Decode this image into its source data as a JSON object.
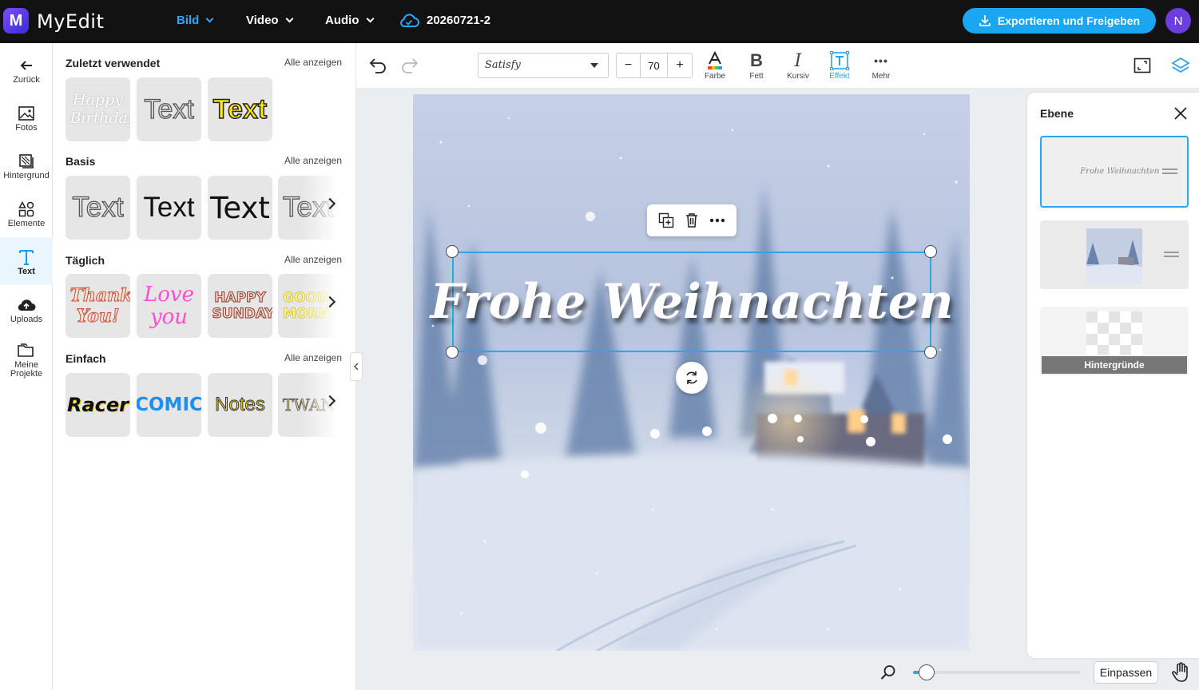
{
  "app": {
    "name": "MyEdit",
    "logo_letter": "M",
    "user_initial": "N"
  },
  "topnav": [
    {
      "label": "Bild",
      "active": true
    },
    {
      "label": "Video",
      "active": false
    },
    {
      "label": "Audio",
      "active": false
    }
  ],
  "project": {
    "name": "20260721-2"
  },
  "export_label": "Exportieren und Freigeben",
  "rail": [
    {
      "label": "Zurück",
      "icon": "back-arrow-icon"
    },
    {
      "label": "Fotos",
      "icon": "photo-icon"
    },
    {
      "label": "Hintergrund",
      "icon": "background-icon"
    },
    {
      "label": "Elemente",
      "icon": "shapes-icon"
    },
    {
      "label": "Text",
      "icon": "text-icon",
      "active": true
    },
    {
      "label": "Uploads",
      "icon": "upload-cloud-icon"
    },
    {
      "label": "Meine Projekte",
      "icon": "folder-icon"
    }
  ],
  "panel": {
    "show_all": "Alle anzeigen",
    "sections": [
      {
        "title": "Zuletzt verwendet",
        "tiles": [
          "Happy Birthday",
          "Text",
          "Text"
        ]
      },
      {
        "title": "Basis",
        "tiles": [
          "Text",
          "Text",
          "Text",
          "Text"
        ]
      },
      {
        "title": "Täglich",
        "tiles": [
          "Thank You!",
          "Love you",
          "HAPPY SUNDAY",
          "GOOD MORNING"
        ]
      },
      {
        "title": "Einfach",
        "tiles": [
          "Racer",
          "COMIC",
          "Notes",
          "TWANG"
        ]
      }
    ]
  },
  "toolbar": {
    "font": "Satisfy",
    "size": "70",
    "minus": "−",
    "plus": "+",
    "tools": [
      {
        "label": "Farbe",
        "glyph": "A"
      },
      {
        "label": "Fett",
        "glyph": "B"
      },
      {
        "label": "Kursiv",
        "glyph": "I"
      },
      {
        "label": "Effekt",
        "glyph": "T",
        "active": true
      },
      {
        "label": "Mehr",
        "glyph": "•••"
      }
    ]
  },
  "canvas": {
    "text": "Frohe Weihnachten"
  },
  "layers": {
    "title": "Ebene",
    "items": [
      {
        "label": "Frohe Weihnachten",
        "selected": true
      },
      {
        "label": ""
      },
      {
        "label": "Hintergründe"
      }
    ]
  },
  "zoom": {
    "fit_label": "Einpassen",
    "level": 0.08
  },
  "colors": {
    "accent": "#1aa6f0",
    "topbar": "#121212",
    "avatar": "#6c3ee0"
  }
}
